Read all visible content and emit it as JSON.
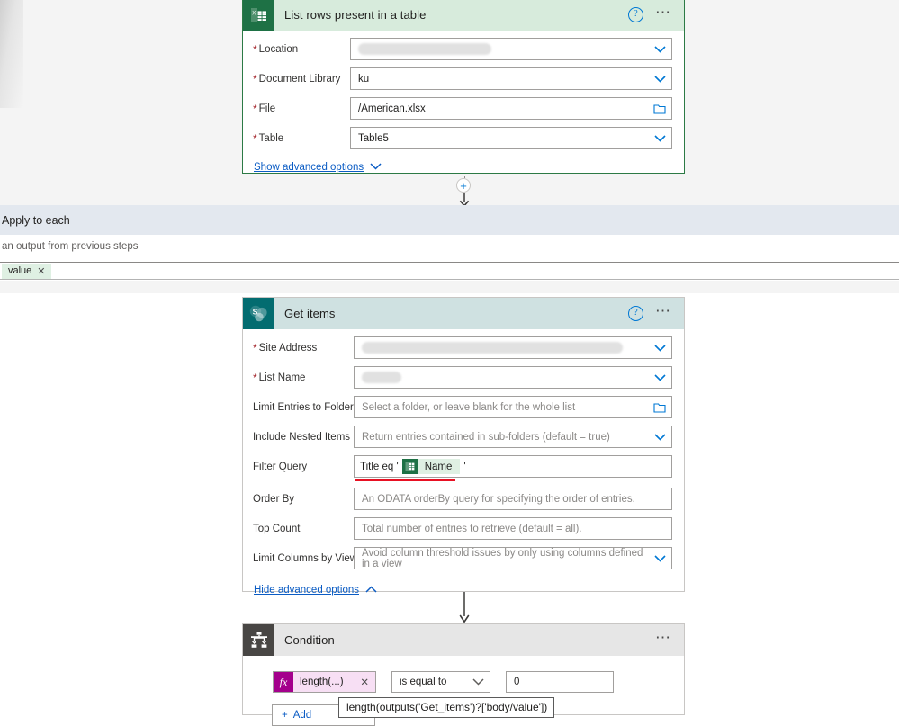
{
  "flow": {
    "cards": [
      {
        "id": "excel",
        "title": "List rows present in a table",
        "icon": "excel-icon",
        "help_icon": "help-icon",
        "more_icon": "more-options-icon",
        "header_color": "#d7ebdc",
        "accent_color": "#1e7145",
        "border_color": "#2c7a45",
        "fields": [
          {
            "label": "Location",
            "required": true,
            "value": "",
            "redacted": true,
            "control": "dropdown",
            "placeholder": ""
          },
          {
            "label": "Document Library",
            "required": true,
            "value": "ku",
            "redacted": false,
            "control": "dropdown",
            "placeholder": ""
          },
          {
            "label": "File",
            "required": true,
            "value": "/American.xlsx",
            "redacted": false,
            "control": "folder",
            "placeholder": ""
          },
          {
            "label": "Table",
            "required": true,
            "value": "Table5",
            "redacted": false,
            "control": "dropdown",
            "placeholder": ""
          }
        ],
        "advanced_link": "Show advanced options",
        "advanced_chevron": "chevron-down-icon"
      },
      {
        "id": "sharepoint",
        "title": "Get items",
        "icon": "sharepoint-icon",
        "help_icon": "help-icon",
        "more_icon": "more-options-icon",
        "header_color": "#cfe1e1",
        "accent_color": "#036c70",
        "border_color": "#c8c6c4",
        "fields": [
          {
            "label": "Site Address",
            "required": true,
            "value": "",
            "redacted": true,
            "control": "dropdown",
            "placeholder": ""
          },
          {
            "label": "List Name",
            "required": true,
            "value": "",
            "redacted": true,
            "control": "dropdown",
            "placeholder": ""
          },
          {
            "label": "Limit Entries to Folder",
            "required": false,
            "value": "",
            "redacted": false,
            "control": "folder",
            "placeholder": "Select a folder, or leave blank for the whole list"
          },
          {
            "label": "Include Nested Items",
            "required": false,
            "value": "",
            "redacted": false,
            "control": "dropdown",
            "placeholder": "Return entries contained in sub-folders (default = true)"
          },
          {
            "label": "Filter Query",
            "required": false,
            "value": "",
            "redacted": false,
            "control": "token",
            "placeholder": ""
          },
          {
            "label": "Order By",
            "required": false,
            "value": "",
            "redacted": false,
            "control": "plain",
            "placeholder": "An ODATA orderBy query for specifying the order of entries."
          },
          {
            "label": "Top Count",
            "required": false,
            "value": "",
            "redacted": false,
            "control": "plain",
            "placeholder": "Total number of entries to retrieve (default = all)."
          },
          {
            "label": "Limit Columns by View",
            "required": false,
            "value": "",
            "redacted": false,
            "control": "dropdown",
            "placeholder": "Avoid column threshold issues by only using columns defined in a view"
          }
        ],
        "filter_query": {
          "prefix": "Title eq '",
          "token_icon": "excel-icon",
          "token_label": "Name",
          "suffix": "'",
          "error_underline_color": "#e81123"
        },
        "advanced_link": "Hide advanced options",
        "advanced_chevron": "chevron-up-icon"
      },
      {
        "id": "condition",
        "title": "Condition",
        "icon": "condition-icon",
        "more_icon": "more-options-icon",
        "header_color": "#e6e6e6",
        "accent_color": "#484644",
        "border_color": "#c8c6c4",
        "expression": {
          "fx_badge": "fx",
          "token_label": "length(...)",
          "remove_icon": "remove-token-icon",
          "operator": "is equal to",
          "operator_chevron": "chevron-down-icon",
          "value": "0"
        },
        "add_button": "Add",
        "add_icon": "plus-icon"
      }
    ],
    "apply_to_each": {
      "title": "Apply to each",
      "subtitle": "an output from previous steps",
      "token": "value",
      "token_remove_icon": "remove-token-icon"
    },
    "connectors": {
      "insert_step_icon": "plus-icon",
      "arrow_icon": "arrow-down-icon"
    },
    "tooltip": {
      "text": "length(outputs('Get_items')?['body/value'])"
    }
  }
}
